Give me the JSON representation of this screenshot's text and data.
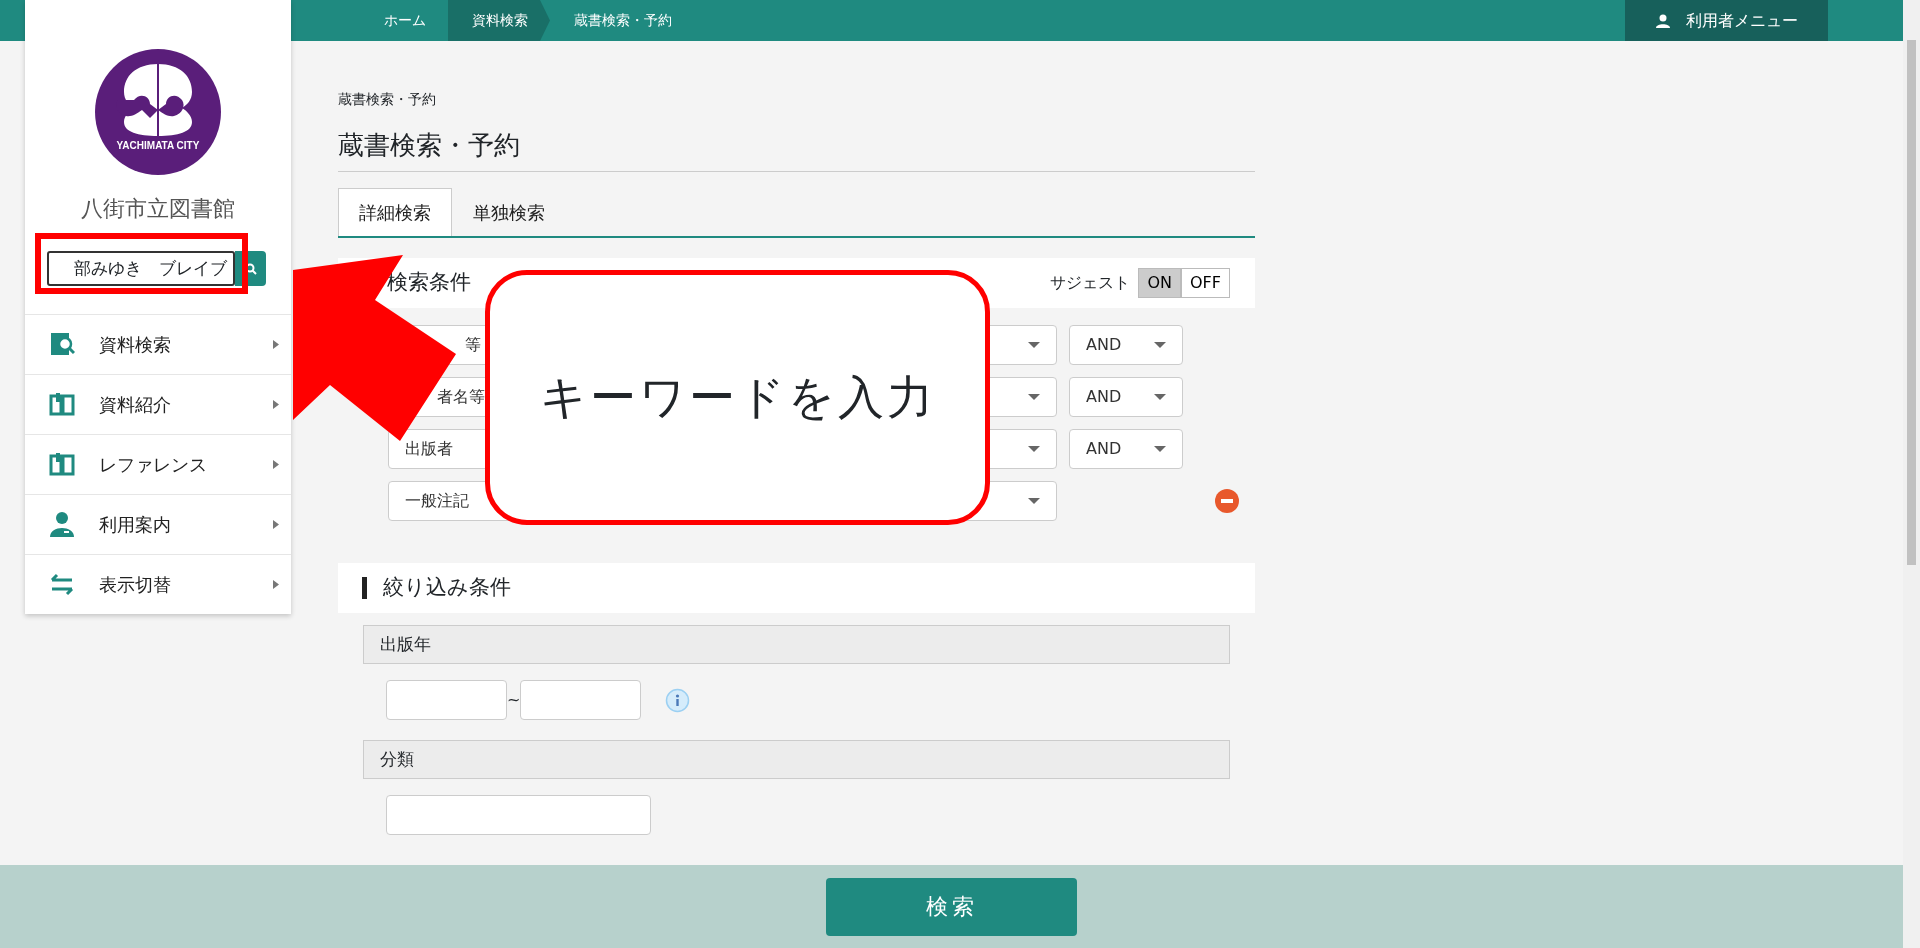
{
  "topbar": {
    "breadcrumbs": [
      {
        "label": "ホーム",
        "selected": false
      },
      {
        "label": "資料検索",
        "selected": true
      },
      {
        "label": "蔵書検索・予約",
        "selected": false
      }
    ],
    "user_menu": "利用者メニュー"
  },
  "sidebar": {
    "logo_text": "YACHIMATA CITY",
    "library_name": "八街市立図書館",
    "search": {
      "value": "部みゆき　ブレイブ"
    },
    "items": [
      {
        "label": "資料検索",
        "kind": "search"
      },
      {
        "label": "資料紹介",
        "kind": "book"
      },
      {
        "label": "レファレンス",
        "kind": "book"
      },
      {
        "label": "利用案内",
        "kind": "person"
      },
      {
        "label": "表示切替",
        "kind": "switch"
      }
    ]
  },
  "main": {
    "breadcrumb": "蔵書検索・予約",
    "title": "蔵書検索・予約",
    "tabs": [
      {
        "label": "詳細検索",
        "selected": true
      },
      {
        "label": "単独検索",
        "selected": false
      }
    ],
    "conditions": {
      "heading": "検索条件",
      "suggest_label": "サジェスト",
      "suggest": [
        {
          "label": "ON",
          "selected": true
        },
        {
          "label": "OFF",
          "selected": false
        }
      ],
      "rows": [
        {
          "field": "等",
          "covered": true,
          "operator": "AND"
        },
        {
          "field": "者名等",
          "covered": true,
          "operator": "AND"
        },
        {
          "field": "出版者",
          "covered": false,
          "operator": "AND"
        },
        {
          "field": "一般注記",
          "covered": false,
          "removable": true
        }
      ]
    },
    "filters": {
      "heading": "絞り込み条件",
      "groups": [
        {
          "label": "出版年",
          "kind": "range",
          "separator": "~"
        },
        {
          "label": "分類",
          "kind": "text"
        }
      ]
    }
  },
  "search_button": "検索",
  "callout": {
    "text": "キーワードを入力"
  }
}
